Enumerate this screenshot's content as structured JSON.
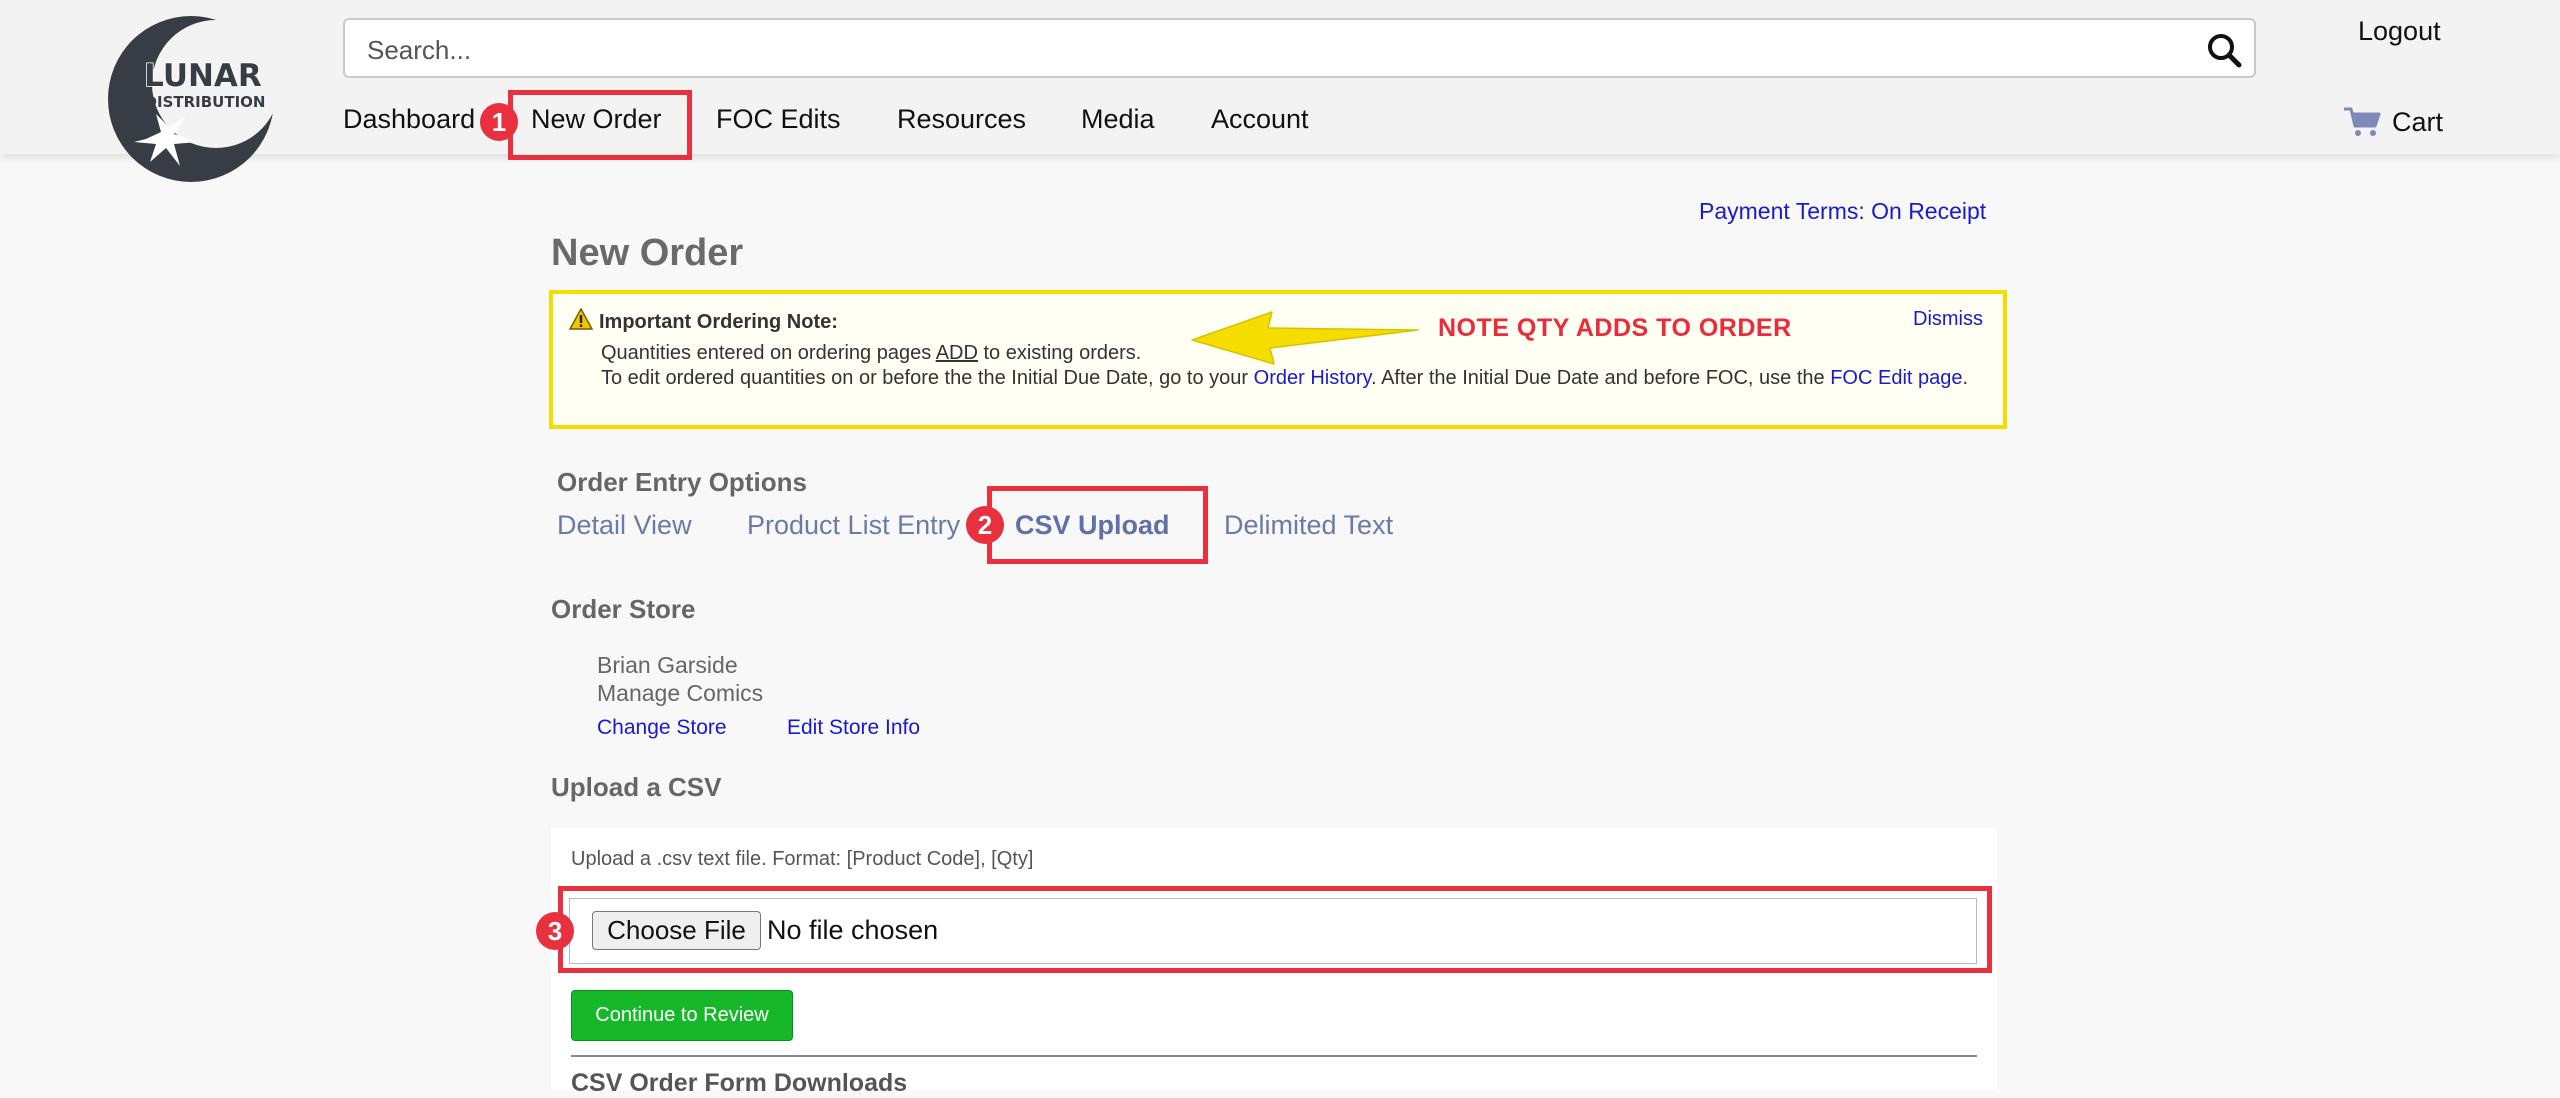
{
  "header": {
    "logo_text_top": "LUNAR",
    "logo_text_bottom": "DISTRIBUTION",
    "search_placeholder": "Search...",
    "logout_label": "Logout",
    "cart_label": "Cart",
    "nav": [
      "Dashboard",
      "New Order",
      "FOC Edits",
      "Resources",
      "Media",
      "Account"
    ]
  },
  "annotations": {
    "badge1": "1",
    "badge2": "2",
    "badge3": "3",
    "note_callout": "NOTE QTY ADDS TO ORDER",
    "colors": {
      "highlight": "#e8303f",
      "note_border": "#f5dd00",
      "callout": "#ec2a3a"
    }
  },
  "page": {
    "payment_terms": "Payment Terms: On Receipt",
    "title": "New Order"
  },
  "note": {
    "heading": "Important Ordering Note:",
    "line1_pre": "Quantities entered on ordering pages ",
    "line1_add": "ADD",
    "line1_post": " to existing orders.",
    "line2_pre": "To edit ordered quantities on or before the the Initial Due Date, go to your ",
    "order_history_link": "Order History",
    "line2_mid": ". After the Initial Due Date and before FOC, use the ",
    "foc_link": "FOC Edit page",
    "line2_end": ".",
    "dismiss_label": "Dismiss"
  },
  "order_entry": {
    "title": "Order Entry Options",
    "options": [
      "Detail View",
      "Product List Entry",
      "CSV Upload",
      "Delimited Text"
    ],
    "active": "CSV Upload"
  },
  "order_store": {
    "title": "Order Store",
    "name": "Brian Garside",
    "store": "Manage Comics",
    "change_link": "Change Store",
    "edit_link": "Edit Store Info"
  },
  "upload": {
    "title": "Upload a CSV",
    "hint": "Upload a .csv text file. Format: [Product Code], [Qty]",
    "choose_label": "Choose File",
    "no_file": "No file chosen",
    "continue_label": "Continue to Review",
    "downloads_title": "CSV Order Form Downloads"
  }
}
